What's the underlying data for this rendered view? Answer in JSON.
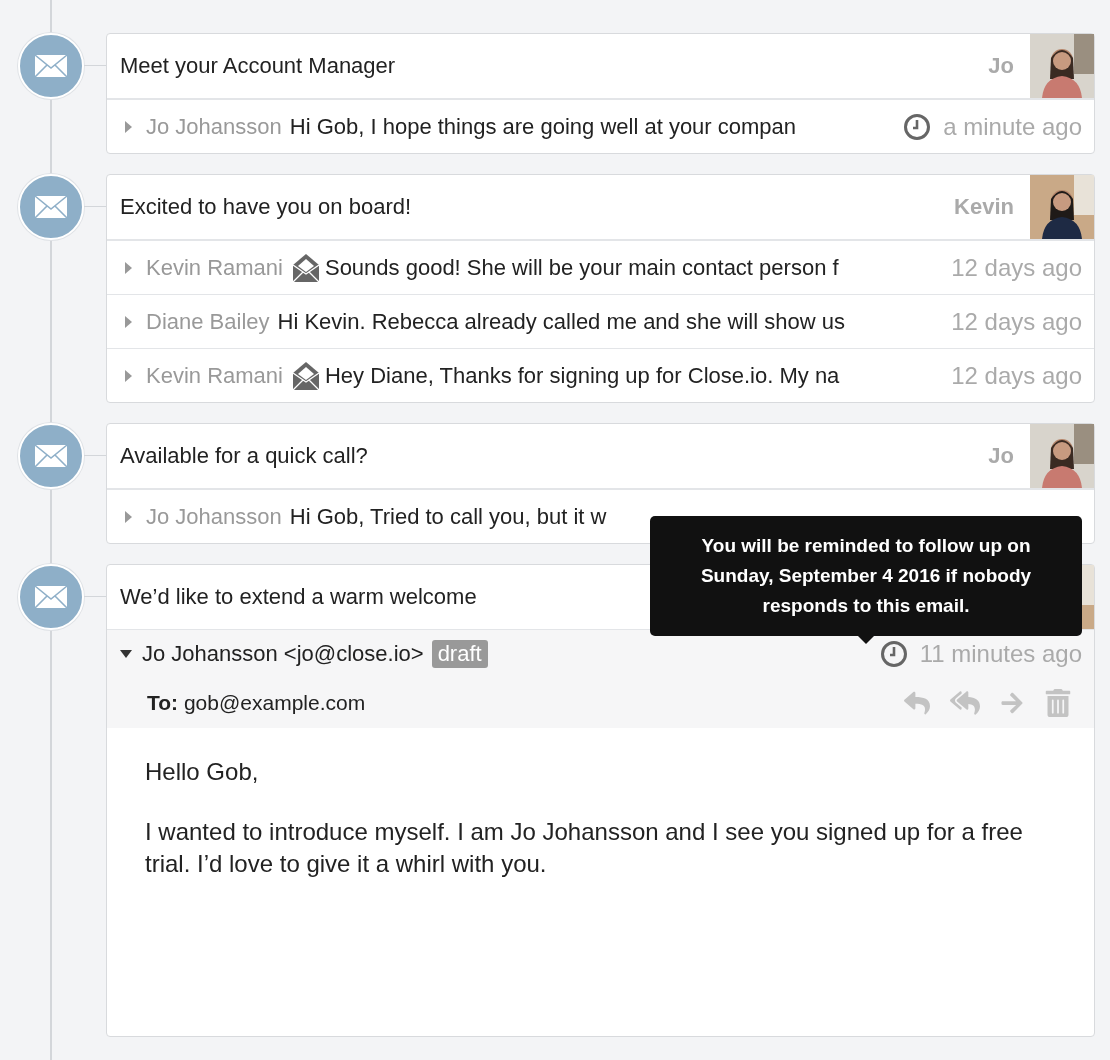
{
  "threads": [
    {
      "subject": "Meet your Account Manager",
      "owner": "Jo",
      "avatar": {
        "kind": "picture"
      },
      "messages": [
        {
          "sender": "Jo Johansson",
          "opened": false,
          "preview": "Hi Gob, I hope things are going well at your compan",
          "reminder": true,
          "time": "a minute ago"
        }
      ]
    },
    {
      "subject": "Excited to have you on board!",
      "owner": "Kevin",
      "avatar": {
        "kind": "picture"
      },
      "messages": [
        {
          "sender": "Kevin Ramani",
          "opened": true,
          "preview": "Sounds good! She will be your main contact person f",
          "reminder": false,
          "time": "12 days ago"
        },
        {
          "sender": "Diane Bailey",
          "opened": false,
          "preview": "Hi Kevin. Rebecca already called me and she will show us",
          "reminder": false,
          "time": "12 days ago"
        },
        {
          "sender": "Kevin Ramani",
          "opened": true,
          "preview": "Hey Diane, Thanks for signing up for Close.io. My na",
          "reminder": false,
          "time": "12 days ago"
        }
      ]
    },
    {
      "subject": "Available for a quick call?",
      "owner": "Jo",
      "avatar": {
        "kind": "picture"
      },
      "messages": [
        {
          "sender": "Jo Johansson",
          "opened": false,
          "preview": "Hi Gob, Tried to call you, but it w",
          "reminder": false
        }
      ]
    },
    {
      "subject": "We’d like to extend a warm welcome",
      "avatar": {
        "kind": "picture"
      },
      "expanded_message": {
        "from": "Jo Johansson <jo@close.io>",
        "badge": "draft",
        "reminder": true,
        "time": "11 minutes ago",
        "to_label": "To:",
        "to": "gob@example.com",
        "body": [
          "Hello Gob,",
          "I wanted to introduce myself. I am Jo Johansson and I see you signed up for a free trial. I’d love to give it a whirl with you."
        ]
      },
      "tooltip": "You will be reminded to follow up on Sunday, September 4 2016 if nobody responds to this email."
    }
  ]
}
